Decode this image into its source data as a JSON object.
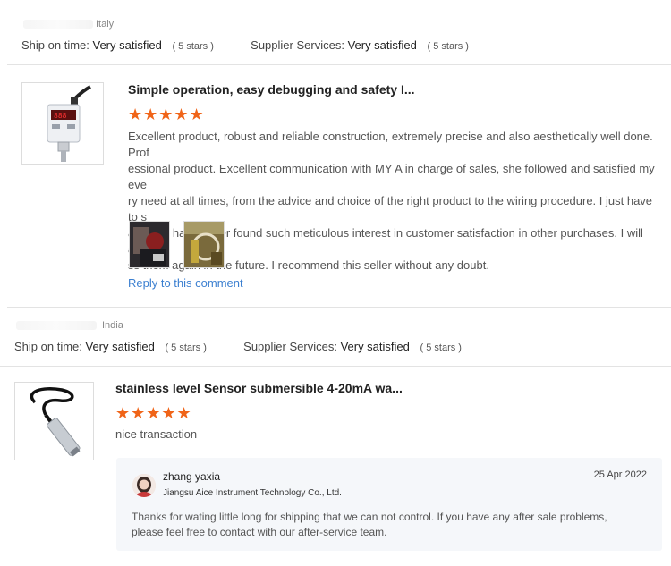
{
  "reviews": [
    {
      "country": "Italy",
      "ship_label": "Ship on time:",
      "ship_value": "Very satisfied",
      "ship_stars": "( 5 stars )",
      "supplier_label": "Supplier Services:",
      "supplier_value": "Very satisfied",
      "supplier_stars": "( 5 stars )",
      "title": "Simple operation, easy debugging and safety I...",
      "stars": "★★★★★",
      "rating": 5,
      "body_lines": [
        "Excellent product, robust and reliable construction, extremely precise and also aesthetically well done. Prof",
        "essional product. Excellent communication with MY A in charge of sales, she followed and satisfied my eve",
        "ry need at all times, from the advice and choice of the right product to the wiring procedure. I just have to s",
        "ay that I have never found such meticulous interest in customer satisfaction in other purchases. I will addre",
        "ss them again in the future. I recommend this seller without any doubt."
      ],
      "reply_link": "Reply to this comment"
    },
    {
      "country": "India",
      "ship_label": "Ship on time:",
      "ship_value": "Very satisfied",
      "ship_stars": "( 5 stars )",
      "supplier_label": "Supplier Services:",
      "supplier_value": "Very satisfied",
      "supplier_stars": "( 5 stars )",
      "title": "stainless level Sensor submersible 4-20mA wa...",
      "stars": "★★★★★",
      "rating": 5,
      "body": "nice transaction",
      "reply": {
        "name": "zhang yaxia",
        "company": "Jiangsu Aice Instrument Technology Co., Ltd.",
        "date": "25 Apr 2022",
        "text_lines": [
          "Thanks for wating little long for shipping that we can not control. If you have any after sale problems,",
          "please feel free to contact with our after-service team."
        ]
      }
    }
  ],
  "colors": {
    "star": "#f06418",
    "link": "#3b7fd0",
    "reply_bg": "#f5f7fa"
  }
}
